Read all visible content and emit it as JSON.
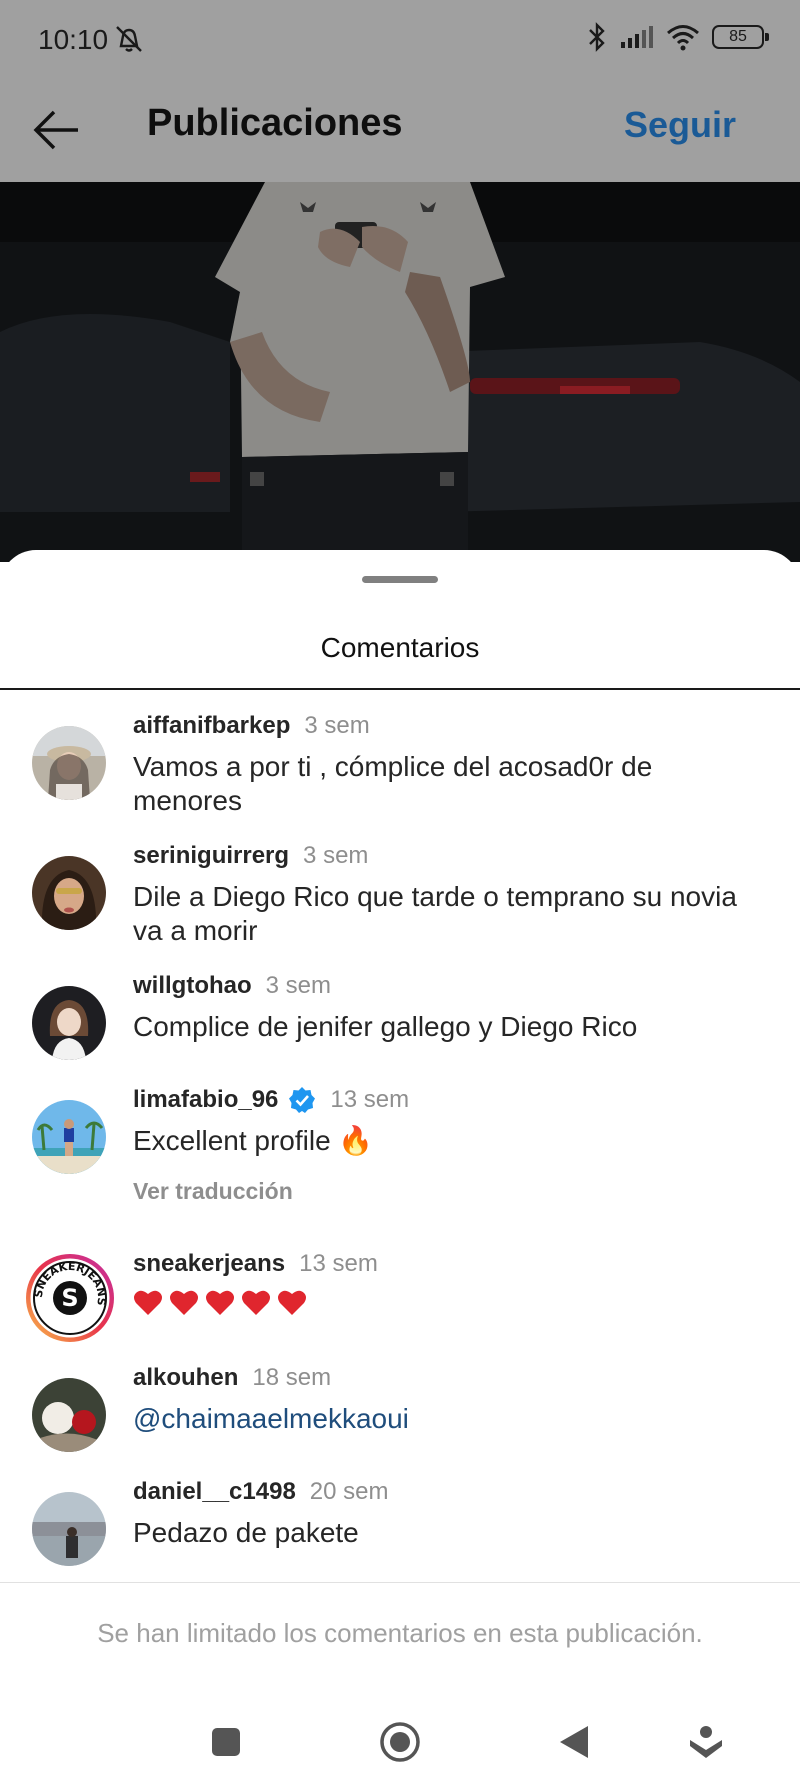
{
  "status_bar": {
    "time": "10:10",
    "icons": [
      "alarm-off-icon",
      "bluetooth-icon",
      "signal-icon",
      "wifi-icon"
    ],
    "battery": "85"
  },
  "header": {
    "back_icon": "back-arrow-icon",
    "title": "Publicaciones",
    "follow_label": "Seguir"
  },
  "sheet": {
    "title": "Comentarios",
    "limited_notice": "Se han limitado los comentarios en esta publicación."
  },
  "comments": [
    {
      "user": "aiffanifbarkep",
      "time": "3 sem",
      "text": "Vamos a por ti , cómplice del acosad0r de menores"
    },
    {
      "user": "seriniguirrerg",
      "time": "3 sem",
      "text": "Dile a Diego Rico que tarde o temprano su novia va a morir"
    },
    {
      "user": "willgtohao",
      "time": "3 sem",
      "text": "Complice de jenifer gallego y Diego Rico"
    },
    {
      "user": "limafabio_96",
      "verified": true,
      "time": "13 sem",
      "text": "Excellent profile 🔥",
      "translate": "Ver traducción"
    },
    {
      "user": "sneakerjeans",
      "time": "13 sem",
      "text": "❤️❤️❤️❤️❤️"
    },
    {
      "user": "alkouhen",
      "time": "18 sem",
      "text": "@chaimaaelmekkaoui"
    },
    {
      "user": "daniel__c1498",
      "time": "20 sem",
      "text": "Pedazo de pakete"
    }
  ],
  "avatar_logo_text": {
    "letter": "S",
    "ring": "SNEAKERJEANS"
  },
  "navbar": {
    "icons": [
      "recents-icon",
      "home-icon",
      "back-icon",
      "assistant-icon"
    ]
  },
  "colors": {
    "accent": "#1a5a96",
    "mention": "#1f4d7c",
    "muted": "#8e8e8e",
    "verified": "#1e96f0"
  }
}
